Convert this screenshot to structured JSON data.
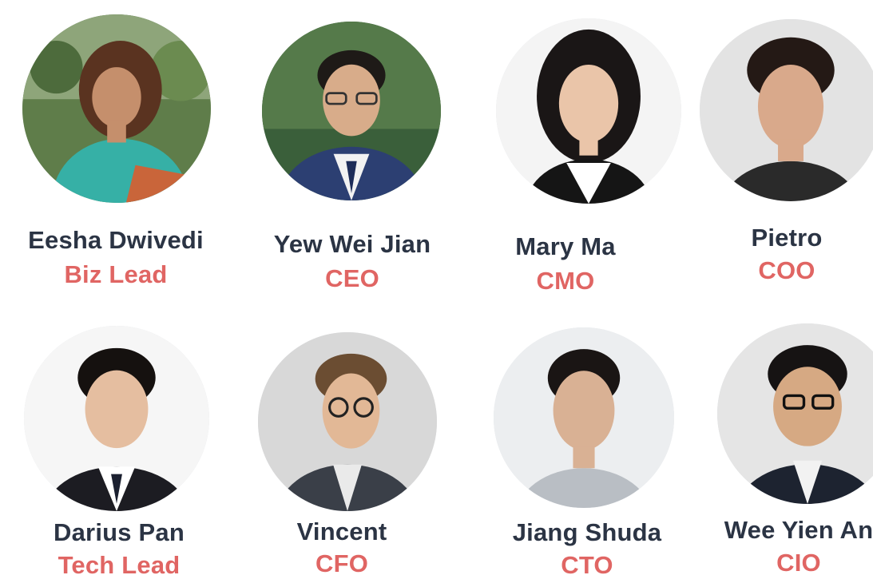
{
  "team": {
    "members": [
      {
        "name": "Eesha Dwivedi",
        "role": "Biz Lead"
      },
      {
        "name": "Yew Wei Jian",
        "role": "CEO"
      },
      {
        "name": "Mary Ma",
        "role": "CMO"
      },
      {
        "name": "Pietro",
        "role": "COO"
      },
      {
        "name": "Darius Pan",
        "role": "Tech Lead"
      },
      {
        "name": "Vincent",
        "role": "CFO"
      },
      {
        "name": "Jiang Shuda",
        "role": "CTO"
      },
      {
        "name": "Wee Yien An",
        "role": "CIO"
      }
    ]
  },
  "colors": {
    "name_text": "#2b3444",
    "role_accent": "#e06563",
    "background": "#ffffff"
  }
}
